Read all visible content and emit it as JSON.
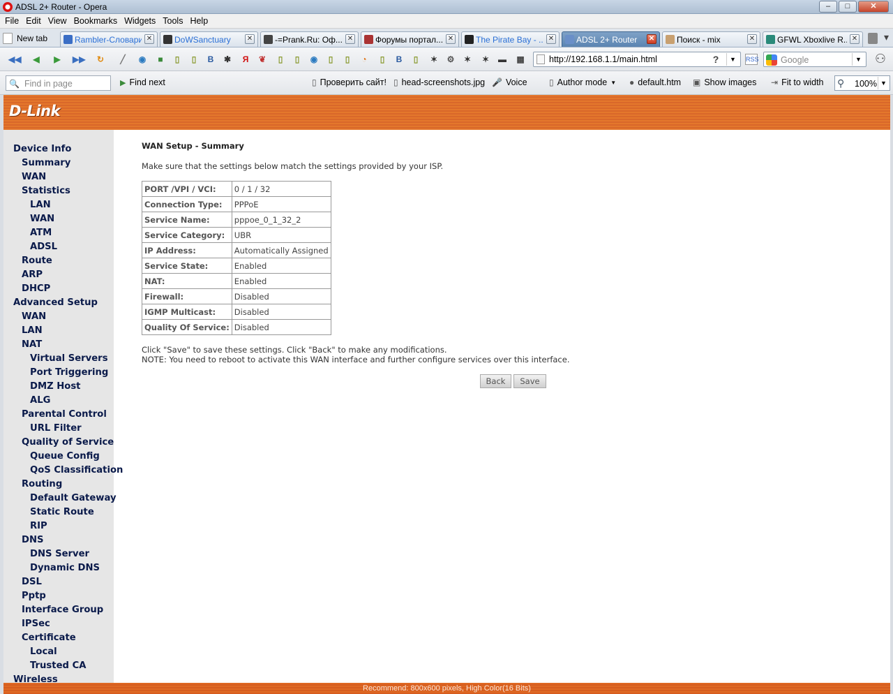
{
  "window": {
    "title": "ADSL 2+ Router - Opera",
    "min": "–",
    "max": "□",
    "close": "✕"
  },
  "menu": [
    {
      "label": "File"
    },
    {
      "label": "Edit"
    },
    {
      "label": "View"
    },
    {
      "label": "Bookmarks"
    },
    {
      "label": "Widgets"
    },
    {
      "label": "Tools"
    },
    {
      "label": "Help"
    }
  ],
  "tabs": {
    "new_tab": "New tab",
    "items": [
      {
        "label": "Rambler-Словари",
        "color": "#2a6fd6"
      },
      {
        "label": "DoWSanctuary",
        "color": "#2a6fd6"
      },
      {
        "label": "-=Prank.Ru: Оф...",
        "color": "#000000"
      },
      {
        "label": "Форумы портал...",
        "color": "#000000"
      },
      {
        "label": "The Pirate Bay - ...",
        "color": "#2a6fd6"
      },
      {
        "label": "ADSL 2+ Router",
        "color": "#ffffff"
      },
      {
        "label": "Поиск - mix",
        "color": "#000000"
      },
      {
        "label": "GFWL Xboxlive R...",
        "color": "#000000"
      }
    ]
  },
  "address": {
    "url": "http://192.168.1.1/main.html",
    "help": "?"
  },
  "search": {
    "placeholder": "Google"
  },
  "findbar": {
    "placeholder": "Find in page",
    "find_next": "Find next",
    "items": [
      "Проверить сайт!",
      "head-screenshots.jpg",
      "Voice",
      "Author mode",
      "default.htm",
      "Show images",
      "Fit to width"
    ],
    "zoom": "100%"
  },
  "brand": {
    "logo": "D-Link"
  },
  "sidebar": [
    {
      "label": "Device Info",
      "level": 0
    },
    {
      "label": "Summary",
      "level": 1
    },
    {
      "label": "WAN",
      "level": 1
    },
    {
      "label": "Statistics",
      "level": 1
    },
    {
      "label": "LAN",
      "level": 2
    },
    {
      "label": "WAN",
      "level": 2
    },
    {
      "label": "ATM",
      "level": 2
    },
    {
      "label": "ADSL",
      "level": 2
    },
    {
      "label": "Route",
      "level": 1
    },
    {
      "label": "ARP",
      "level": 1
    },
    {
      "label": "DHCP",
      "level": 1
    },
    {
      "label": "Advanced Setup",
      "level": 0
    },
    {
      "label": "WAN",
      "level": 1
    },
    {
      "label": "LAN",
      "level": 1
    },
    {
      "label": "NAT",
      "level": 1
    },
    {
      "label": "Virtual Servers",
      "level": 2
    },
    {
      "label": "Port Triggering",
      "level": 2
    },
    {
      "label": "DMZ Host",
      "level": 2
    },
    {
      "label": "ALG",
      "level": 2
    },
    {
      "label": "Parental Control",
      "level": 1
    },
    {
      "label": "URL Filter",
      "level": 2
    },
    {
      "label": "Quality of Service",
      "level": 1
    },
    {
      "label": "Queue Config",
      "level": 2
    },
    {
      "label": "QoS Classification",
      "level": 2
    },
    {
      "label": "Routing",
      "level": 1
    },
    {
      "label": "Default Gateway",
      "level": 2
    },
    {
      "label": "Static Route",
      "level": 2
    },
    {
      "label": "RIP",
      "level": 2
    },
    {
      "label": "DNS",
      "level": 1
    },
    {
      "label": "DNS Server",
      "level": 2
    },
    {
      "label": "Dynamic DNS",
      "level": 2
    },
    {
      "label": "DSL",
      "level": 1
    },
    {
      "label": "Pptp",
      "level": 1
    },
    {
      "label": "Interface Group",
      "level": 1
    },
    {
      "label": "IPSec",
      "level": 1
    },
    {
      "label": "Certificate",
      "level": 1
    },
    {
      "label": "Local",
      "level": 2
    },
    {
      "label": "Trusted CA",
      "level": 2
    },
    {
      "label": "Wireless",
      "level": 0
    }
  ],
  "main": {
    "heading": "WAN Setup - Summary",
    "intro": "Make sure that the settings below match the settings provided by your ISP.",
    "rows": [
      {
        "key": "PORT /VPI / VCI:",
        "value": "0 / 1 / 32"
      },
      {
        "key": "Connection Type:",
        "value": "PPPoE"
      },
      {
        "key": "Service Name:",
        "value": "pppoe_0_1_32_2"
      },
      {
        "key": "Service Category:",
        "value": "UBR"
      },
      {
        "key": "IP Address:",
        "value": "Automatically Assigned"
      },
      {
        "key": "Service State:",
        "value": "Enabled"
      },
      {
        "key": "NAT:",
        "value": "Enabled"
      },
      {
        "key": "Firewall:",
        "value": "Disabled"
      },
      {
        "key": "IGMP Multicast:",
        "value": "Disabled"
      },
      {
        "key": "Quality Of Service:",
        "value": "Disabled"
      }
    ],
    "note1": "Click \"Save\" to save these settings. Click \"Back\" to make any modifications.",
    "note2": "NOTE: You need to reboot to activate this WAN interface and further configure services over this interface.",
    "back": "Back",
    "save": "Save"
  },
  "footer": "Recommend: 800x600 pixels, High Color(16 Bits)"
}
